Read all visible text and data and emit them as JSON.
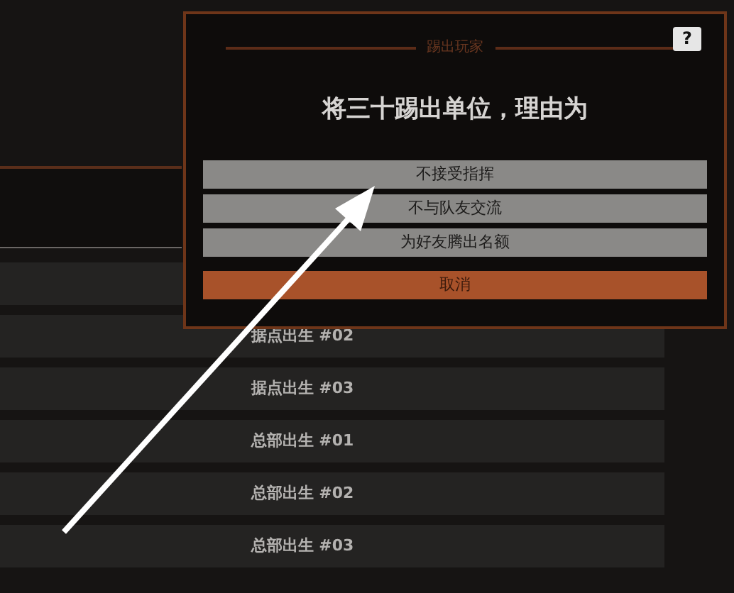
{
  "spawn_list": [
    {
      "label": "据点出生 #02"
    },
    {
      "label": "据点出生 #03"
    },
    {
      "label": "总部出生 #01"
    },
    {
      "label": "总部出生 #02"
    },
    {
      "label": "总部出生 #03"
    }
  ],
  "dialog": {
    "heading": "踢出玩家",
    "help": "?",
    "title": "将三十踢出单位，理由为",
    "reasons": [
      {
        "label": "不接受指挥"
      },
      {
        "label": "不与队友交流"
      },
      {
        "label": "为好友腾出名额"
      }
    ],
    "cancel": "取消"
  }
}
